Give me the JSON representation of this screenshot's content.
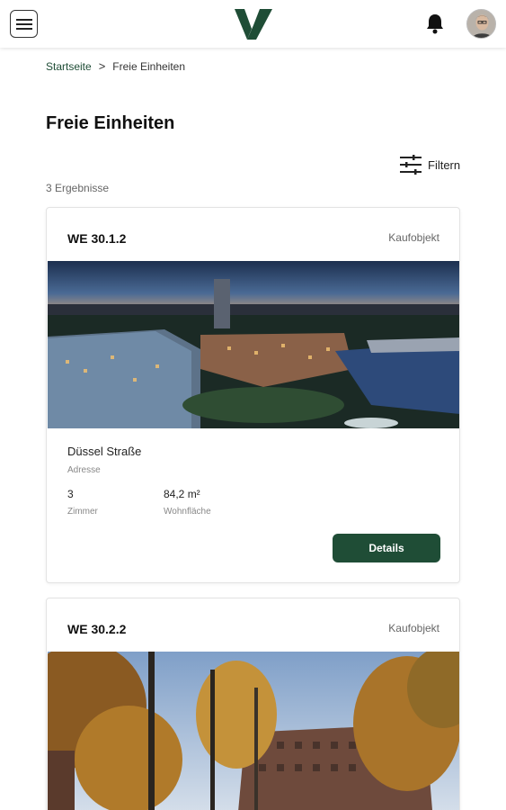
{
  "header": {
    "menu_icon": "hamburger-menu-icon",
    "logo_icon": "v-logo",
    "bell_icon": "bell-icon",
    "avatar_icon": "user-avatar",
    "brand_color": "#1f4d36"
  },
  "breadcrumb": {
    "home": "Startseite",
    "separator": ">",
    "current": "Freie Einheiten"
  },
  "page": {
    "title": "Freie Einheiten",
    "filter_label": "Filtern",
    "filter_icon": "sliders-icon",
    "result_count": "3 Ergebnisse"
  },
  "units": [
    {
      "id": "WE 30.1.2",
      "type": "Kaufobjekt",
      "address": "Düssel Straße",
      "address_label": "Adresse",
      "rooms": "3",
      "rooms_label": "Zimmer",
      "area": "84,2 m²",
      "area_label": "Wohnfläche",
      "button_label": "Details"
    },
    {
      "id": "WE 30.2.2",
      "type": "Kaufobjekt"
    }
  ]
}
